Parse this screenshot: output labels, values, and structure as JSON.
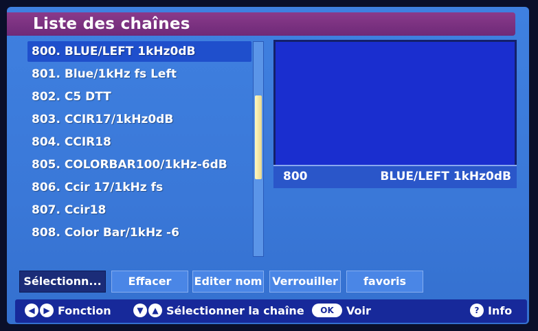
{
  "header": {
    "title": "Liste des chaînes"
  },
  "channels": [
    {
      "label": "800. BLUE/LEFT 1kHz0dB"
    },
    {
      "label": "801. Blue/1kHz fs Left"
    },
    {
      "label": "802. C5 DTT"
    },
    {
      "label": "803. CCIR17/1kHz0dB"
    },
    {
      "label": "804. CCIR18"
    },
    {
      "label": "805. COLORBAR100/1kHz-6dB"
    },
    {
      "label": "806. Ccir 17/1kHz fs"
    },
    {
      "label": "807. Ccir18"
    },
    {
      "label": "808. Color Bar/1kHz -6"
    }
  ],
  "preview": {
    "number": "800",
    "name": "BLUE/LEFT 1kHz0dB"
  },
  "buttons": {
    "select": "Sélectionn...",
    "delete": "Effacer",
    "edit": "Editer nom",
    "lock": "Verrouiller",
    "favorites": "favoris"
  },
  "help": {
    "function": "Fonction",
    "select_channel": "Sélectionner la chaîne",
    "ok": "OK",
    "view": "Voir",
    "info_icon": "?",
    "info": "Info"
  },
  "icons": {
    "left": "◀",
    "right": "▶",
    "down": "▼",
    "up": "▲"
  },
  "colors": {
    "background": "#3f80e0",
    "title_bar": "#7a3080",
    "selection": "#1f4fcc",
    "preview": "#1a2ecf",
    "help_bar": "#17299a"
  }
}
